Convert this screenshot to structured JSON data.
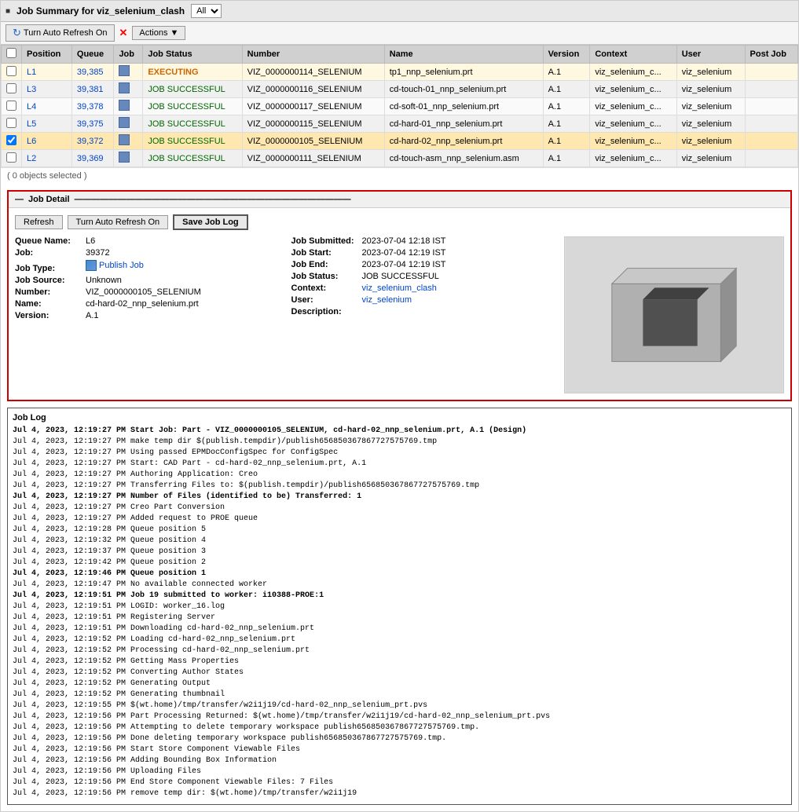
{
  "header": {
    "title": "Job Summary for viz_selenium_clash",
    "filter_label": "All",
    "filter_options": [
      "All"
    ]
  },
  "toolbar": {
    "refresh_label": "Turn Auto Refresh On",
    "actions_label": "Actions"
  },
  "table": {
    "columns": [
      "",
      "Position",
      "Queue",
      "Job",
      "Job Status",
      "Number",
      "Name",
      "Version",
      "Context",
      "User",
      "Post Job"
    ],
    "rows": [
      {
        "position": "L1",
        "queue": "39,385",
        "job_icon": true,
        "status": "EXECUTING",
        "number": "VIZ_0000000114_SELENIUM",
        "name": "tp1_nnp_selenium.prt",
        "version": "A.1",
        "context": "viz_selenium_c...",
        "user": "viz_selenium",
        "post_job": "",
        "selected": false,
        "executing": true
      },
      {
        "position": "L3",
        "queue": "39,381",
        "job_icon": true,
        "status": "JOB SUCCESSFUL",
        "number": "VIZ_0000000116_SELENIUM",
        "name": "cd-touch-01_nnp_selenium.prt",
        "version": "A.1",
        "context": "viz_selenium_c...",
        "user": "viz_selenium",
        "post_job": "",
        "selected": false,
        "executing": false
      },
      {
        "position": "L4",
        "queue": "39,378",
        "job_icon": true,
        "status": "JOB SUCCESSFUL",
        "number": "VIZ_0000000117_SELENIUM",
        "name": "cd-soft-01_nnp_selenium.prt",
        "version": "A.1",
        "context": "viz_selenium_c...",
        "user": "viz_selenium",
        "post_job": "",
        "selected": false,
        "executing": false
      },
      {
        "position": "L5",
        "queue": "39,375",
        "job_icon": true,
        "status": "JOB SUCCESSFUL",
        "number": "VIZ_0000000115_SELENIUM",
        "name": "cd-hard-01_nnp_selenium.prt",
        "version": "A.1",
        "context": "viz_selenium_c...",
        "user": "viz_selenium",
        "post_job": "",
        "selected": false,
        "executing": false
      },
      {
        "position": "L6",
        "queue": "39,372",
        "job_icon": true,
        "status": "JOB SUCCESSFUL",
        "number": "VIZ_0000000105_SELENIUM",
        "name": "cd-hard-02_nnp_selenium.prt",
        "version": "A.1",
        "context": "viz_selenium_c...",
        "user": "viz_selenium",
        "post_job": "",
        "selected": true,
        "executing": false
      },
      {
        "position": "L2",
        "queue": "39,369",
        "job_icon": true,
        "status": "JOB SUCCESSFUL",
        "number": "VIZ_0000000111_SELENIUM",
        "name": "cd-touch-asm_nnp_selenium.asm",
        "version": "A.1",
        "context": "viz_selenium_c...",
        "user": "viz_selenium",
        "post_job": "",
        "selected": false,
        "executing": false
      }
    ],
    "selection_info": "( 0 objects selected )"
  },
  "job_detail": {
    "section_title": "Job Detail",
    "buttons": {
      "refresh": "Refresh",
      "auto_refresh": "Turn Auto Refresh On",
      "save_log": "Save Job Log"
    },
    "fields_left": {
      "queue_name_label": "Queue Name:",
      "queue_name_value": "L6",
      "job_label": "Job:",
      "job_value": "39372",
      "job_type_label": "Job Type:",
      "job_type_value": "Publish Job",
      "job_source_label": "Job Source:",
      "job_source_value": "Unknown",
      "number_label": "Number:",
      "number_value": "VIZ_0000000105_SELENIUM",
      "name_label": "Name:",
      "name_value": "cd-hard-02_nnp_selenium.prt",
      "version_label": "Version:",
      "version_value": "A.1"
    },
    "fields_right": {
      "submitted_label": "Job Submitted:",
      "submitted_value": "2023-07-04 12:18 IST",
      "start_label": "Job Start:",
      "start_value": "2023-07-04 12:19 IST",
      "end_label": "Job End:",
      "end_value": "2023-07-04 12:19 IST",
      "status_label": "Job Status:",
      "status_value": "JOB SUCCESSFUL",
      "context_label": "Context:",
      "context_value": "viz_selenium_clash",
      "user_label": "User:",
      "user_value": "viz_selenium",
      "description_label": "Description:",
      "description_value": ""
    }
  },
  "job_log": {
    "title": "Job Log",
    "lines": [
      "Jul 4, 2023, 12:19:27 PM Start Job: Part - VIZ_0000000105_SELENIUM, cd-hard-02_nnp_selenium.prt, A.1 (Design)",
      "Jul 4, 2023, 12:19:27 PM make temp dir $(publish.tempdir)/publish656850367867727575769.tmp",
      "Jul 4, 2023, 12:19:27 PM Using passed EPMDocConfigSpec for ConfigSpec",
      "Jul 4, 2023, 12:19:27 PM Start: CAD Part - cd-hard-02_nnp_selenium.prt, A.1",
      "Jul 4, 2023, 12:19:27 PM Authoring Application: Creo",
      "Jul 4, 2023, 12:19:27 PM Transferring Files to: $(publish.tempdir)/publish656850367867727575769.tmp",
      "Jul 4, 2023, 12:19:27 PM Number of Files (identified to be) Transferred: 1",
      "Jul 4, 2023, 12:19:27 PM Creo Part Conversion",
      "Jul 4, 2023, 12:19:27 PM Added request to PROE queue",
      "Jul 4, 2023, 12:19:28 PM Queue position 5",
      "Jul 4, 2023, 12:19:32 PM Queue position 4",
      "Jul 4, 2023, 12:19:37 PM Queue position 3",
      "Jul 4, 2023, 12:19:42 PM Queue position 2",
      "Jul 4, 2023, 12:19:46 PM Queue position 1",
      "Jul 4, 2023, 12:19:47 PM No available connected worker",
      "Jul 4, 2023, 12:19:51 PM Job 19 submitted to worker: i10388-PROE:1",
      "Jul 4, 2023, 12:19:51 PM LOGID: worker_16.log",
      "Jul 4, 2023, 12:19:51 PM Registering Server",
      "Jul 4, 2023, 12:19:51 PM Downloading cd-hard-02_nnp_selenium.prt",
      "Jul 4, 2023, 12:19:52 PM Loading cd-hard-02_nnp_selenium.prt",
      "Jul 4, 2023, 12:19:52 PM Processing cd-hard-02_nnp_selenium.prt",
      "Jul 4, 2023, 12:19:52 PM Getting Mass Properties",
      "Jul 4, 2023, 12:19:52 PM Converting Author States",
      "Jul 4, 2023, 12:19:52 PM Generating Output",
      "Jul 4, 2023, 12:19:52 PM Generating thumbnail",
      "Jul 4, 2023, 12:19:55 PM $(wt.home)/tmp/transfer/w2i1j19/cd-hard-02_nnp_selenium_prt.pvs",
      "Jul 4, 2023, 12:19:56 PM Part Processing Returned: $(wt.home)/tmp/transfer/w2i1j19/cd-hard-02_nnp_selenium_prt.pvs",
      "Jul 4, 2023, 12:19:56 PM Attempting to delete temporary workspace publish656850367867727575769.tmp.",
      "Jul 4, 2023, 12:19:56 PM Done deleting temporary workspace publish656850367867727575769.tmp.",
      "Jul 4, 2023, 12:19:56 PM Start Store Component Viewable Files",
      "Jul 4, 2023, 12:19:56 PM Adding Bounding Box Information",
      "Jul 4, 2023, 12:19:56 PM Uploading Files",
      "Jul 4, 2023, 12:19:56 PM End Store Component Viewable Files: 7 Files",
      "Jul 4, 2023, 12:19:56 PM remove temp dir: $(wt.home)/tmp/transfer/w2i1j19"
    ],
    "bold_lines": [
      0,
      6,
      13,
      15
    ]
  }
}
